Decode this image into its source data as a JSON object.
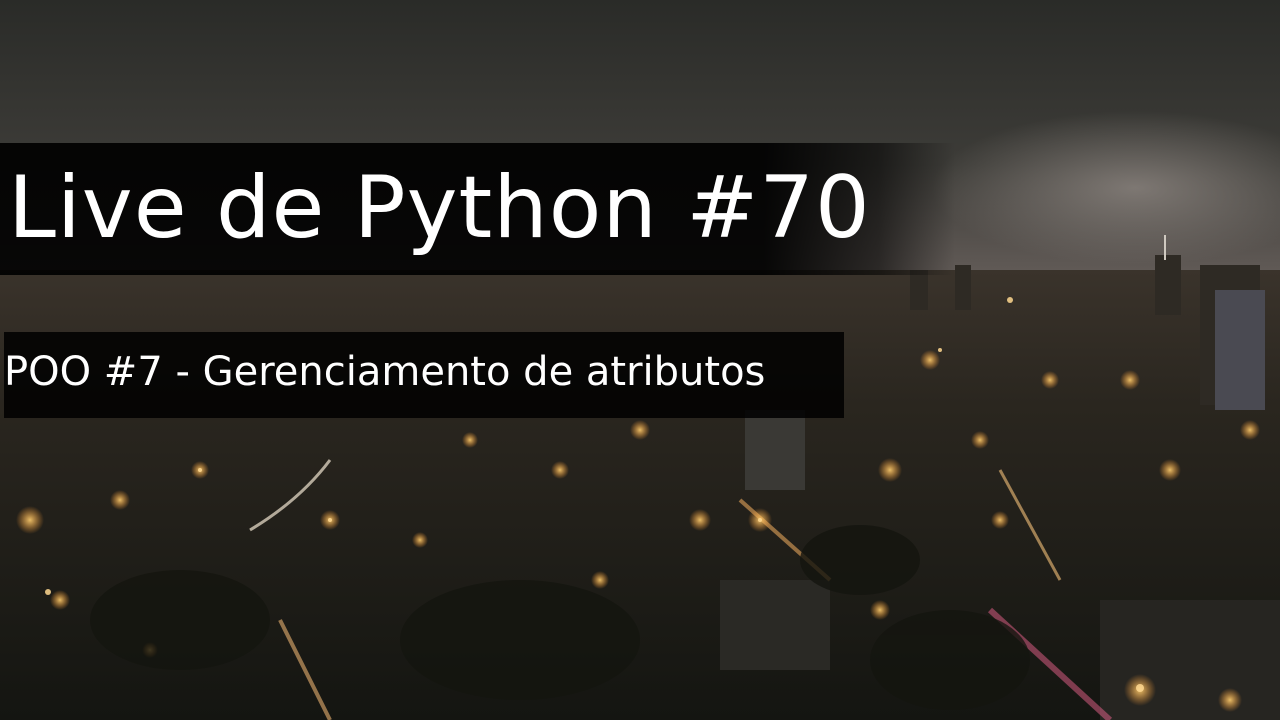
{
  "slide": {
    "title": "Live de Python #70",
    "subtitle": "POO #7 - Gerenciamento de atributos"
  },
  "background": {
    "description_icon": "city-night-skyline-photo",
    "colors": {
      "sky_top": "#2b2c29",
      "sky_horizon": "#5a5653",
      "city_dark": "#1d1c18",
      "city_light": "#f2a23a"
    }
  }
}
